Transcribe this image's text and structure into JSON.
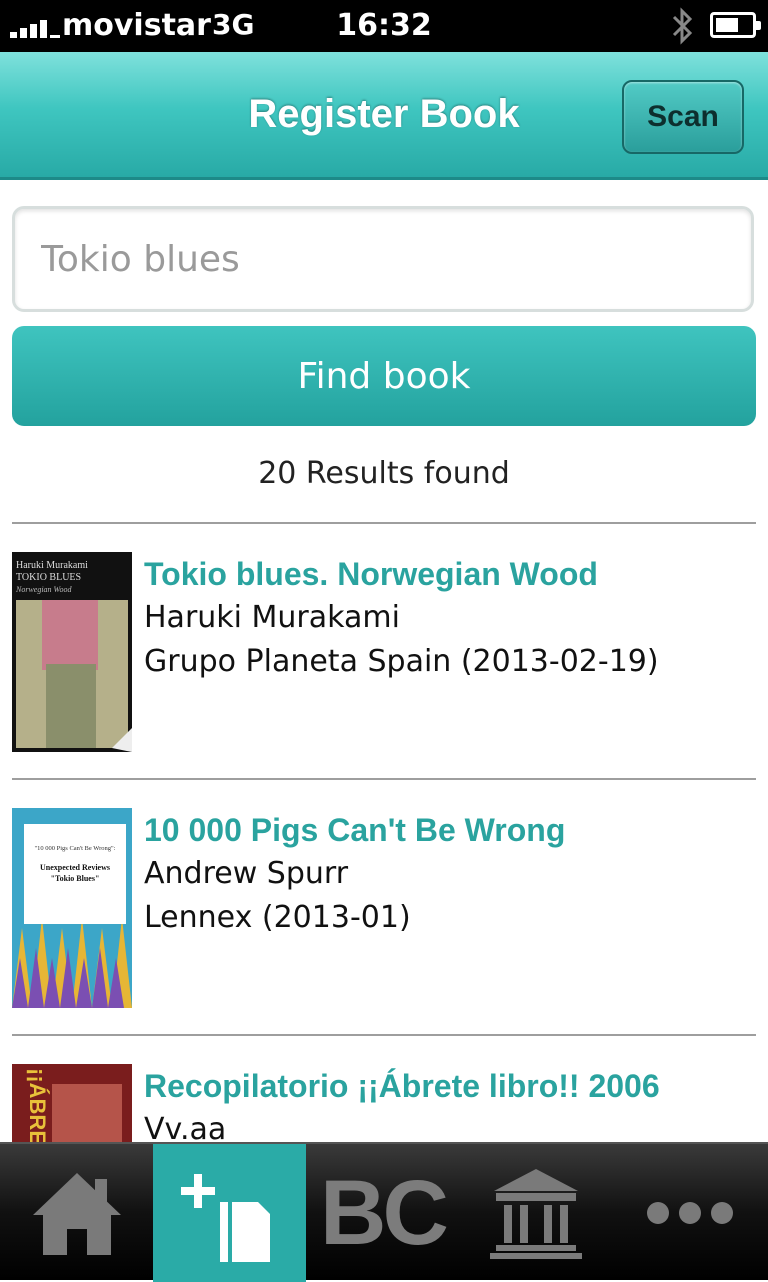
{
  "status_bar": {
    "carrier": "movistar",
    "network": "3G",
    "time": "16:32"
  },
  "nav": {
    "title": "Register Book",
    "scan_label": "Scan"
  },
  "search": {
    "value": "Tokio blues",
    "button_label": "Find book",
    "results_text": "20 Results found"
  },
  "books": [
    {
      "title": "Tokio blues. Norwegian Wood",
      "author": "Haruki Murakami",
      "publisher": "Grupo Planeta Spain (2013-02-19)",
      "cover_text": [
        "Haruki Murakami",
        "TOKIO BLUES",
        "Norwegian Wood"
      ]
    },
    {
      "title": "10 000 Pigs Can't Be Wrong",
      "author": "Andrew Spurr",
      "publisher": "Lennex (2013-01)",
      "cover_text": [
        "\"10 000 Pigs Can't Be Wrong\":",
        "Unexpected Reviews",
        "\"Tokio Blues\""
      ]
    },
    {
      "title": "Recopilatorio ¡¡Ábrete libro!! 2006",
      "author": "Vv.aa",
      "publisher": "",
      "cover_text": [
        "¡¡ÁBRETE"
      ]
    }
  ],
  "tabs": [
    {
      "icon": "home-icon",
      "active": false
    },
    {
      "icon": "add-book-icon",
      "active": true
    },
    {
      "icon": "bc-icon",
      "label": "BC",
      "active": false
    },
    {
      "icon": "library-icon",
      "active": false
    },
    {
      "icon": "more-icon",
      "active": false
    }
  ],
  "colors": {
    "accent": "#2aa39f",
    "nav_top": "#7fe1dc",
    "nav_bottom": "#28aaa6",
    "tabbar": "#000000"
  }
}
